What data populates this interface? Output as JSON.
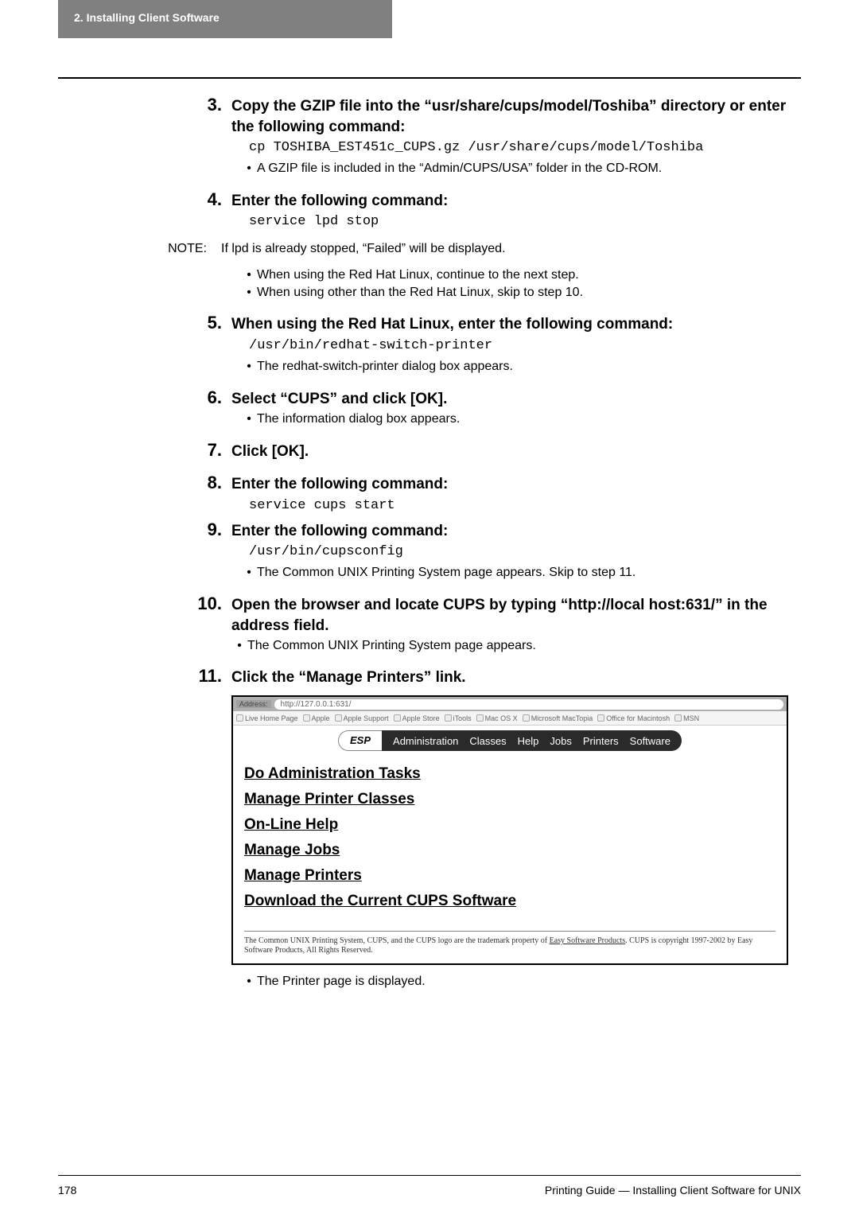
{
  "header": {
    "tab": "2. Installing Client Software"
  },
  "steps": {
    "s3": {
      "num": "3.",
      "title": "Copy the GZIP file into the “usr/share/cups/model/Toshiba” directory or enter the following command:",
      "code": "cp TOSHIBA_EST451c_CUPS.gz /usr/share/cups/model/Toshiba",
      "bullet": "A GZIP file is included in the “Admin/CUPS/USA” folder in the CD-ROM."
    },
    "s4": {
      "num": "4.",
      "title": "Enter the following command:",
      "code": "service lpd stop"
    },
    "note": {
      "label": "NOTE:",
      "text": "If lpd is already stopped, “Failed” will be displayed.",
      "b1": "When using the Red Hat Linux, continue to the next step.",
      "b2": "When using other than the Red Hat Linux, skip to step 10."
    },
    "s5": {
      "num": "5.",
      "title": "When using the Red Hat Linux, enter the following command:",
      "code": "/usr/bin/redhat-switch-printer",
      "bullet": "The redhat-switch-printer dialog box appears."
    },
    "s6": {
      "num": "6.",
      "title": "Select “CUPS” and click [OK].",
      "bullet": "The information dialog box appears."
    },
    "s7": {
      "num": "7.",
      "title": "Click [OK]."
    },
    "s8": {
      "num": "8.",
      "title": "Enter the following command:",
      "code": "service cups start"
    },
    "s9": {
      "num": "9.",
      "title": "Enter the following command:",
      "code": "/usr/bin/cupsconfig",
      "bullet": "The Common UNIX Printing System page appears. Skip to step 11."
    },
    "s10": {
      "num": "10.",
      "title": "Open the browser and locate CUPS by typing “http://local host:631/” in the address field.",
      "bullet": "The Common UNIX Printing System page appears."
    },
    "s11": {
      "num": "11.",
      "title": "Click the “Manage Printers” link.",
      "after_bullet": "The Printer page is displayed."
    }
  },
  "screenshot": {
    "address_label": "Address:",
    "address_url": "http://127.0.0.1:631/",
    "bookmarks": [
      "Live Home Page",
      "Apple",
      "Apple Support",
      "Apple Store",
      "iTools",
      "Mac OS X",
      "Microsoft MacTopia",
      "Office for Macintosh",
      "MSN"
    ],
    "tabs": {
      "esp": "ESP",
      "items": [
        "Administration",
        "Classes",
        "Help",
        "Jobs",
        "Printers",
        "Software"
      ]
    },
    "links": [
      "Do Administration Tasks",
      "Manage Printer Classes",
      "On-Line Help",
      "Manage Jobs",
      "Manage Printers",
      "Download the Current CUPS Software"
    ],
    "footer_a": "The Common UNIX Printing System, CUPS, and the CUPS logo are the trademark property of ",
    "footer_link": "Easy Software Products",
    "footer_b": ". CUPS is copyright 1997-2002 by Easy Software Products, All Rights Reserved."
  },
  "footer": {
    "page": "178",
    "right": "Printing Guide — Installing Client Software for UNIX"
  }
}
